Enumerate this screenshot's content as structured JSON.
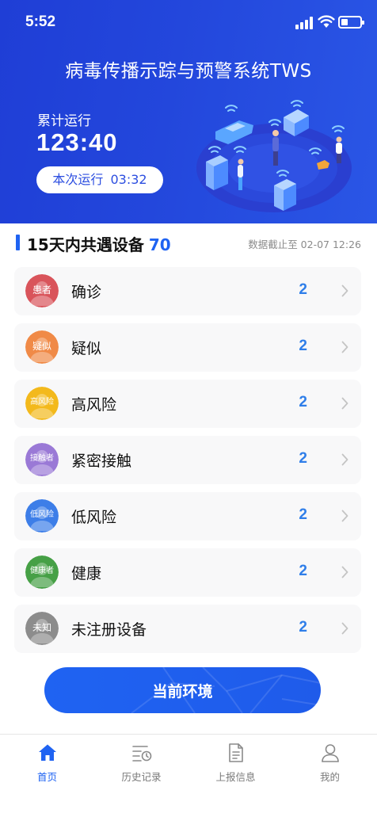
{
  "status_bar": {
    "time": "5:52"
  },
  "header": {
    "title": "病毒传播示踪与预警系统TWS",
    "cumulative_label": "累计运行",
    "cumulative_value": "123:40",
    "current_label": "本次运行",
    "current_value": "03:32"
  },
  "section": {
    "title": "15天内共遇设备",
    "count": "70",
    "as_of": "数据截止至 02-07 12:26"
  },
  "devices": [
    {
      "tag": "患者",
      "label": "确诊",
      "count": "2",
      "color": "#d9545b"
    },
    {
      "tag": "疑似",
      "label": "疑似",
      "count": "2",
      "color": "#f08a47"
    },
    {
      "tag": "高风险",
      "label": "高风险",
      "count": "2",
      "color": "#f3b91c"
    },
    {
      "tag": "接触者",
      "label": "紧密接触",
      "count": "2",
      "color": "#9a79d6"
    },
    {
      "tag": "低风险",
      "label": "低风险",
      "count": "2",
      "color": "#3d7ee8"
    },
    {
      "tag": "健康者",
      "label": "健康",
      "count": "2",
      "color": "#46a046"
    },
    {
      "tag": "未知",
      "label": "未注册设备",
      "count": "2",
      "color": "#8c8c8c"
    }
  ],
  "main_button": {
    "label": "当前环境"
  },
  "tabs": [
    {
      "label": "首页",
      "icon": "home-icon",
      "active": true
    },
    {
      "label": "历史记录",
      "icon": "history-icon",
      "active": false
    },
    {
      "label": "上报信息",
      "icon": "report-icon",
      "active": false
    },
    {
      "label": "我的",
      "icon": "profile-icon",
      "active": false
    }
  ],
  "colors": {
    "primary": "#1f63f2",
    "header_bg": "#2347dc",
    "count_blue": "#2f7ee9"
  }
}
